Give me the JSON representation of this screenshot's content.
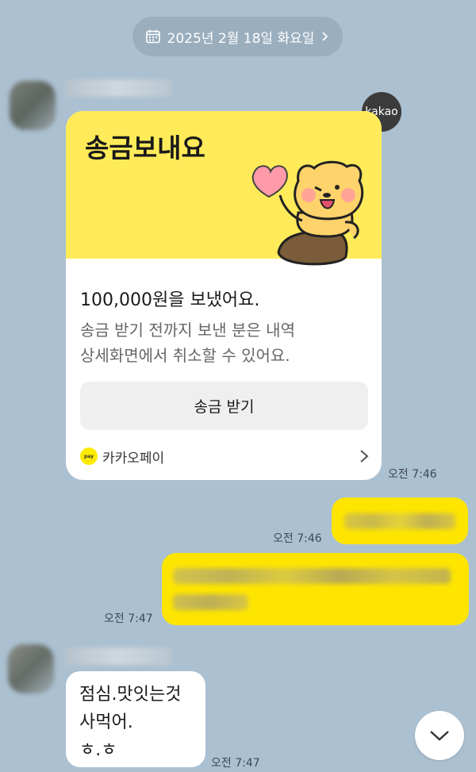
{
  "date_divider": {
    "label": "2025년 2월 18일 화요일"
  },
  "badge": {
    "label": "kakao"
  },
  "transfer_card": {
    "title": "송금보내요",
    "amount_text": "100,000원을 보냈어요.",
    "description_lines": [
      "송금 받기 전까지 보낸 분은 내역",
      "상세화면에서 취소할 수 있어요."
    ],
    "receive_button": "송금 받기",
    "footer_label": "카카오페이",
    "pay_logo_text": "pay"
  },
  "messages": [
    {
      "time": "오전 7:46"
    },
    {
      "time": "오전 7:46"
    },
    {
      "time": "오전 7:47"
    },
    {
      "lines": [
        "점심.맛잇는것",
        "사먹어.",
        "ㅎ.ㅎ"
      ],
      "time": "오전 7:47"
    }
  ],
  "colors": {
    "background": "#abc0d1",
    "my_bubble": "#fee500",
    "card_header": "#ffeb59"
  },
  "icons": [
    "calendar-icon",
    "chevron-right-icon",
    "heart-icon",
    "character-illustration",
    "pay-logo-icon",
    "chevron-down-icon"
  ]
}
